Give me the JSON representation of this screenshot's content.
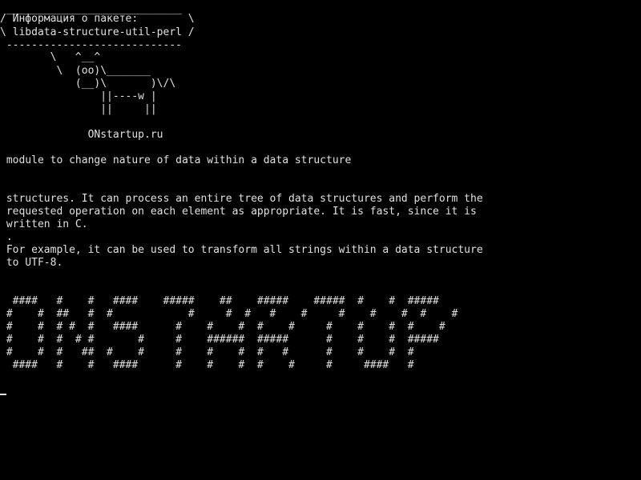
{
  "screen": {
    "colors": {
      "background": "#000000",
      "foreground": "#e0e0e0"
    }
  },
  "cowsay": {
    "bubble_top": " ____________________________",
    "bubble_line1": "/ Информация о пакете:        \\",
    "bubble_line2": "\\ libdata-structure-util-perl /",
    "bubble_bottom": " ----------------------------",
    "cow_line1": "        \\   ^__^",
    "cow_line2": "         \\  (oo)\\_______",
    "cow_line3": "            (__)\\       )\\/\\",
    "cow_line4": "                ||----w |",
    "cow_line5": "                ||     ||",
    "site": "              ONstartup.ru"
  },
  "description": {
    "summary": " module to change nature of data within a data structure",
    "line1": " structures. It can process an entire tree of data structures and perform the",
    "line2": " requested operation on each element as appropriate. It is fast, since it is",
    "line3": " written in C.",
    "line4": " .",
    "line5": " For example, it can be used to transform all strings within a data structure",
    "line6": " to UTF-8."
  },
  "banner": {
    "row1": "  ####   #    #   ####    #####    ##    #####    #####  #    #  #####",
    "row2": " #    #  ##   #  #            #     #  #   #    #     #    #    #  #    #",
    "row3": " #    #  # #  #   ####      #    #    #  #    #     #    #    #  #    #",
    "row4": " #    #  #  # #       #     #    ######  #####      #    #    #  #####",
    "row5": " #    #  #   ##  #    #     #    #    #  #   #      #    #    #  #",
    "row6": "  ####   #    #   ####      #    #    #  #    #     #     ####   #"
  }
}
